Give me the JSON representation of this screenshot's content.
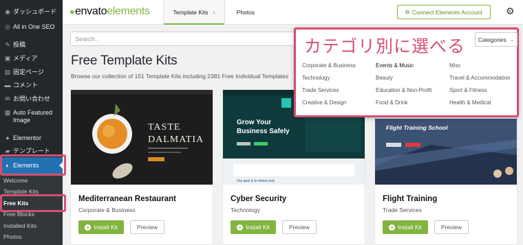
{
  "sidebar": {
    "items": [
      {
        "icon": "dashboard-icon",
        "glyph": "◉",
        "label": "ダッシュボード"
      },
      {
        "icon": "seo-icon",
        "glyph": "◎",
        "label": "All in One SEO"
      },
      {
        "icon": "pin-icon",
        "glyph": "✎",
        "label": "投稿"
      },
      {
        "icon": "media-icon",
        "glyph": "▣",
        "label": "メディア"
      },
      {
        "icon": "page-icon",
        "glyph": "▤",
        "label": "固定ページ"
      },
      {
        "icon": "comment-icon",
        "glyph": "▬",
        "label": "コメント"
      },
      {
        "icon": "mail-icon",
        "glyph": "✉",
        "label": "お問い合わせ"
      },
      {
        "icon": "image-icon",
        "glyph": "▦",
        "label": "Auto Featured Image"
      },
      {
        "icon": "elementor-icon",
        "glyph": "●",
        "label": "Elementor"
      },
      {
        "icon": "template-icon",
        "glyph": "▰",
        "label": "テンプレート"
      },
      {
        "icon": "elements-icon",
        "glyph": "◐",
        "label": "Elements"
      }
    ],
    "subitems": [
      "Welcome",
      "Template Kits",
      "Free Kits",
      "Free Blocks",
      "Installed Kits",
      "Photos"
    ]
  },
  "header": {
    "logo_envato": "envato",
    "logo_elements": "elements",
    "tabs": [
      "Template Kits",
      "Photos"
    ],
    "connect_label": "Connect Elements Account"
  },
  "main": {
    "search_placeholder": "Search...",
    "title": "Free Template Kits",
    "subtitle": "Browse our collection of 151 Template Kits including 2381 Free Individual Templates"
  },
  "categories": {
    "annotation": "カテゴリ別に選べる",
    "dropdown_label": "Categories",
    "items": [
      [
        "Corporate & Business",
        "Events & Music",
        "Misc"
      ],
      [
        "Technology",
        "Beauty",
        "Travel & Accommodation"
      ],
      [
        "Trade Services",
        "Education & Non-Profit",
        "Sport & Fitness"
      ],
      [
        "Creative & Design",
        "Food & Drink",
        "Health & Medical"
      ]
    ]
  },
  "cards": [
    {
      "title": "Mediterranean Restaurant",
      "category": "Corporate & Business",
      "install": "Install Kit",
      "preview": "Preview",
      "thumb_text": [
        "TASTE",
        "DALMATIA"
      ]
    },
    {
      "title": "Cyber Security",
      "category": "Technology",
      "install": "Install Kit",
      "preview": "Preview",
      "thumb_text": [
        "Grow Your",
        "Business Safely",
        "Our goal is to detect and"
      ]
    },
    {
      "title": "Flight Training",
      "category": "Trade Services",
      "install": "Install Kit",
      "preview": "Preview",
      "thumb_text": [
        "Flight Training School"
      ]
    }
  ],
  "colors": {
    "brand_green": "#82b440",
    "annotation_pink": "#d64f70",
    "wp_sidebar": "#23282d",
    "wp_active_blue": "#2271b1"
  }
}
